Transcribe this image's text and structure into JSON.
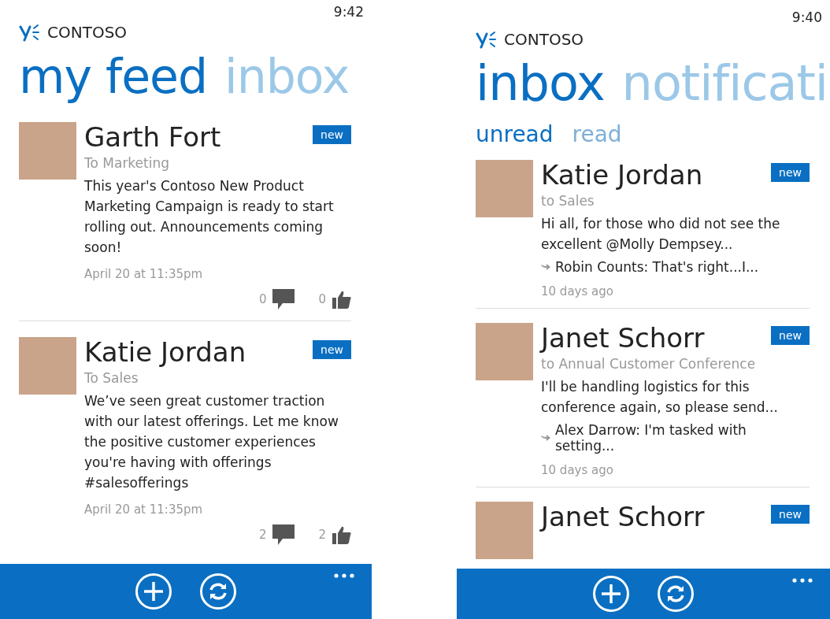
{
  "screens": [
    {
      "status_time": "9:42",
      "brand": "CONTOSO",
      "pivots": [
        {
          "label": "my feed",
          "selected": true
        },
        {
          "label": "inbox",
          "selected": false
        }
      ],
      "posts": [
        {
          "name": "Garth Fort",
          "to": "To Marketing",
          "badge": "new",
          "body": "This year's Contoso New Product Marketing Campaign is ready to start rolling out. Announcements coming soon!",
          "time": "April 20 at 11:35pm",
          "comments": "0",
          "likes": "0"
        },
        {
          "name": "Katie Jordan",
          "to": "To Sales",
          "badge": "new",
          "body": "We’ve seen great customer traction with our latest offerings. Let me know the positive customer experiences you're having with offerings #salesofferings",
          "time": "April 20 at 11:35pm",
          "comments": "2",
          "likes": "2"
        }
      ]
    },
    {
      "status_time": "9:40",
      "brand": "CONTOSO",
      "pivots": [
        {
          "label": "inbox",
          "selected": true
        },
        {
          "label": "notificati",
          "selected": false
        }
      ],
      "sub_pivots": [
        {
          "label": "unread",
          "selected": true
        },
        {
          "label": "read",
          "selected": false
        }
      ],
      "messages": [
        {
          "name": "Katie Jordan",
          "to": "to Sales",
          "badge": "new",
          "body": "Hi all, for those who did not see the excellent @Molly Dempsey...",
          "reply": "Robin Counts: That's right...I...",
          "time": "10 days ago"
        },
        {
          "name": "Janet Schorr",
          "to": "to Annual Customer Conference",
          "badge": "new",
          "body": "I'll be handling logistics for this conference again, so please send...",
          "reply": "Alex Darrow: I'm tasked with setting...",
          "time": "10 days ago"
        },
        {
          "name": "Janet Schorr",
          "badge": "new"
        }
      ]
    }
  ]
}
